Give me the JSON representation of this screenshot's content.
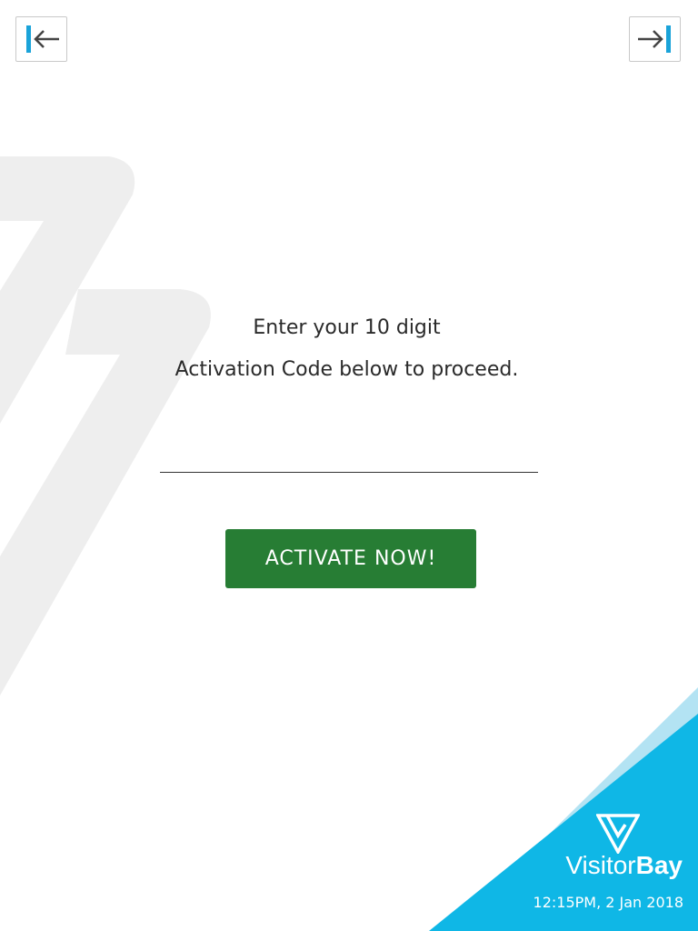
{
  "navigation": {
    "back_icon": "arrow-left-to-bar-icon",
    "forward_icon": "arrow-right-to-bar-icon",
    "accent_color": "#1aa3d9",
    "icon_color": "#444444"
  },
  "activation": {
    "line1": "Enter your 10 digit",
    "line2": "Activation Code below to proceed.",
    "code_value": "",
    "button_label": "ACTIVATE NOW!",
    "button_color": "#277d34"
  },
  "brand": {
    "name_light": "Visitor",
    "name_bold": "Bay",
    "timestamp": "12:15PM, 2 Jan 2018",
    "corner_color": "#0fb7e6",
    "corner_light_color": "#b3e3f3",
    "logo_icon": "visitorbay-v-logo-icon"
  },
  "watermark_color": "#eeeeee"
}
